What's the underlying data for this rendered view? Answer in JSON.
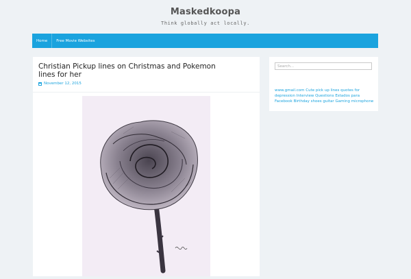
{
  "site": {
    "title": "Maskedkoopa",
    "tagline": "Think globally act locally."
  },
  "nav": {
    "items": [
      {
        "label": "Home"
      },
      {
        "label": "Free Movie Websites"
      }
    ]
  },
  "post": {
    "title": "Christian Pickup lines on Christmas and Pokemon lines for her",
    "date": "November 12, 2015",
    "image_icon": "rose-drawing"
  },
  "sidebar": {
    "search_placeholder": "Search...",
    "tags": [
      "www.gmail.com",
      "Cute pick up lines",
      "quotes for depression",
      "Interview Questions",
      "Estados para Facebook",
      "Birthday",
      "shoes",
      "guitar",
      "Gaming microphone"
    ]
  },
  "colors": {
    "accent": "#1aa3de",
    "background": "#eef2f5"
  }
}
